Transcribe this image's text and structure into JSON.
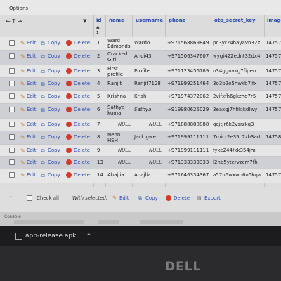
{
  "options": {
    "label": "Options",
    "arrows": "← T →"
  },
  "columns": {
    "id": "id",
    "name": "name",
    "username": "username",
    "phone": "phone",
    "otp": "otp_secret_key",
    "image": "image"
  },
  "row_actions": {
    "edit": "Edit",
    "copy": "Copy",
    "delete": "Delete"
  },
  "rows": [
    {
      "id": "1",
      "name": "Ward Edmonds",
      "username": "Wardo",
      "phone": "+971568869849",
      "otp": "pc3yr24hayavn32x",
      "image": "14757"
    },
    {
      "id": "2",
      "name": "Cracked Girl",
      "username": "Andi43",
      "phone": "+971506347607",
      "otp": "wygj422ednt32dx4",
      "image": "14757"
    },
    {
      "id": "3",
      "name": "First profile",
      "username": "Profile",
      "phone": "+971123456789",
      "otp": "n34gguvkg7fipen",
      "image": "14757"
    },
    {
      "id": "4",
      "name": "Ranjit",
      "username": "Ranjit7128",
      "phone": "+971999251464",
      "otp": "3o3b2o5hwkb7jfx",
      "image": "14757"
    },
    {
      "id": "5",
      "name": "Krishna",
      "username": "Krish",
      "phone": "+971974372062",
      "otp": "2vifxfh6gkzhd7r5",
      "image": "14757"
    },
    {
      "id": "6",
      "name": "Sathya kumar",
      "username": "Sathya",
      "phone": "+919980625029",
      "otp": "3eaxgj7hfikjkdlwy",
      "image": "14757"
    },
    {
      "id": "7",
      "name": "NULL",
      "username": "NULL",
      "phone": "+971888888888",
      "otp": "qejtjr6k2vsrzkq3",
      "image": ""
    },
    {
      "id": "8",
      "name": "Neon HSH",
      "username": "Jack gwe",
      "phone": "+971999111111",
      "otp": "7micr2e35c7zh3art",
      "image": "14758"
    },
    {
      "id": "9",
      "name": "NULL",
      "username": "NULL",
      "phone": "+971999111111",
      "otp": "fyke244fkk354jm",
      "image": ""
    },
    {
      "id": "13",
      "name": "NULL",
      "username": "NULL",
      "phone": "+971333333333",
      "otp": "l2nb5ytervzcm7fh",
      "image": ""
    },
    {
      "id": "14",
      "name": "Ahajlia",
      "username": "Ahajlia",
      "phone": "+971646334367",
      "otp": "a57n6wxwo6u5kqa",
      "image": "14757"
    }
  ],
  "footer": {
    "check_all": "Check all",
    "with_selected": "With selected:",
    "edit": "Edit",
    "copy": "Copy",
    "delete": "Delete",
    "export": "Export"
  },
  "bottom": {
    "console": "Console"
  },
  "taskbar": {
    "file": "app-release.apk",
    "chevron": "^"
  },
  "brand": "DELL"
}
